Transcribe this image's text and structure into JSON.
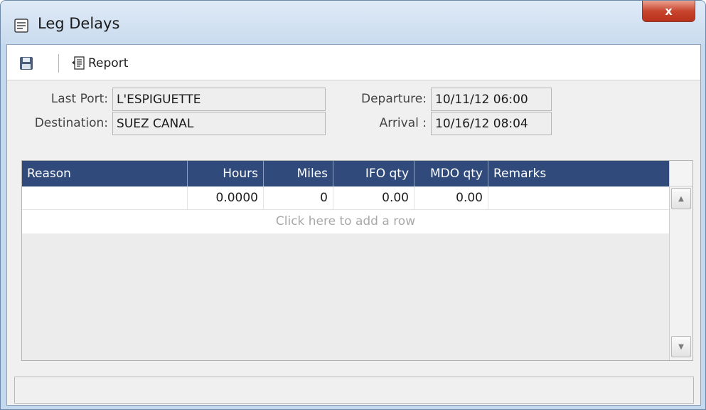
{
  "window": {
    "title": "Leg Delays",
    "close_label": "x"
  },
  "toolbar": {
    "save_icon": "floppy-disk-icon",
    "report_icon": "report-document-icon",
    "report_label": "Report"
  },
  "form": {
    "last_port_label": "Last Port:",
    "last_port_value": "L'ESPIGUETTE",
    "destination_label": "Destination:",
    "destination_value": "SUEZ CANAL",
    "departure_label": "Departure:",
    "departure_value": "10/11/12 06:00",
    "arrival_label": "Arrival :",
    "arrival_value": "10/16/12 08:04"
  },
  "grid": {
    "columns": [
      "Reason",
      "Hours",
      "Miles",
      "IFO qty",
      "MDO qty",
      "Remarks"
    ],
    "rows": [
      {
        "reason": "",
        "hours": "0.0000",
        "miles": "0",
        "ifo_qty": "0.00",
        "mdo_qty": "0.00",
        "remarks": ""
      }
    ],
    "add_row_text": "Click here to add a row"
  },
  "colors": {
    "header_bg": "#2f4a7b",
    "title_bar": "#c9dbee",
    "close_button": "#c8452d"
  }
}
